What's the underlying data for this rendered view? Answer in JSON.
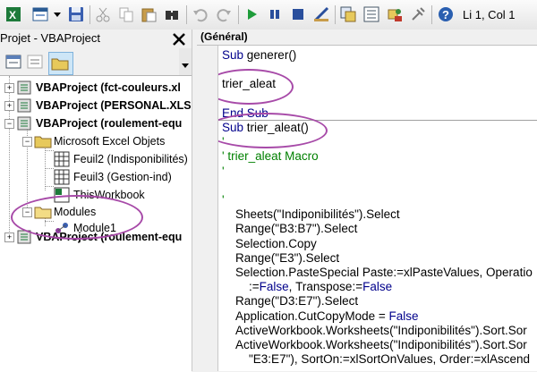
{
  "toolbar": {
    "icons": [
      "excel-icon",
      "insert-userform-icon",
      "dropdown-arrow-icon",
      "save-icon",
      "cut-icon",
      "copy-icon",
      "paste-icon",
      "find-icon",
      "undo-icon",
      "redo-icon",
      "run-icon",
      "break-icon",
      "reset-icon",
      "design-mode-icon",
      "project-explorer-icon",
      "properties-icon",
      "object-browser-icon",
      "toolbox-icon",
      "help-icon"
    ],
    "cursor_position": "Li 1, Col 1"
  },
  "project_panel": {
    "title": "Projet - VBAProject",
    "tree": [
      {
        "label": "VBAProject (fct-couleurs.xl",
        "bold": true,
        "expander": "+"
      },
      {
        "label": "VBAProject (PERSONAL.XLS",
        "bold": true,
        "expander": "+"
      },
      {
        "label": "VBAProject (roulement-equ",
        "bold": true,
        "expander": "-"
      },
      {
        "label": "Microsoft Excel Objets",
        "bold": false,
        "expander": "-"
      },
      {
        "label": "Feuil2 (Indisponibilités)",
        "bold": false
      },
      {
        "label": "Feuil3 (Gestion-ind)",
        "bold": false
      },
      {
        "label": "ThisWorkbook",
        "bold": false
      },
      {
        "label": "Modules",
        "bold": false,
        "expander": "-"
      },
      {
        "label": "Module1",
        "bold": false
      },
      {
        "label": "VBAProject (roulement-equ",
        "bold": true,
        "expander": "+"
      }
    ]
  },
  "code_panel": {
    "object_dropdown": "(Général)",
    "lines": [
      [
        {
          "t": "Sub ",
          "c": "kw"
        },
        {
          "t": "generer()",
          "c": ""
        }
      ],
      [],
      [
        {
          "t": "trier_aleat",
          "c": ""
        }
      ],
      [],
      [
        {
          "t": "End Sub",
          "c": "kw"
        }
      ],
      [
        {
          "t": "Sub ",
          "c": "kw"
        },
        {
          "t": "trier_aleat()",
          "c": ""
        }
      ],
      [
        {
          "t": "'",
          "c": "cm"
        }
      ],
      [
        {
          "t": "' trier_aleat Macro",
          "c": "cm"
        }
      ],
      [
        {
          "t": "'",
          "c": "cm"
        }
      ],
      [],
      [
        {
          "t": "'",
          "c": "cm"
        }
      ],
      [
        {
          "t": "    Sheets(\"Indiponibilités\").Select",
          "c": ""
        }
      ],
      [
        {
          "t": "    Range(\"B3:B7\").Select",
          "c": ""
        }
      ],
      [
        {
          "t": "    Selection.Copy",
          "c": ""
        }
      ],
      [
        {
          "t": "    Range(\"E3\").Select",
          "c": ""
        }
      ],
      [
        {
          "t": "    Selection.PasteSpecial Paste:=xlPasteValues, Operatio",
          "c": ""
        }
      ],
      [
        {
          "t": "        :=",
          "c": ""
        },
        {
          "t": "False",
          "c": "kw"
        },
        {
          "t": ", Transpose:=",
          "c": ""
        },
        {
          "t": "False",
          "c": "kw"
        }
      ],
      [
        {
          "t": "    Range(\"D3:E7\").Select",
          "c": ""
        }
      ],
      [
        {
          "t": "    Application.CutCopyMode = ",
          "c": ""
        },
        {
          "t": "False",
          "c": "kw"
        }
      ],
      [
        {
          "t": "    ActiveWorkbook.Worksheets(\"Indiponibilités\").Sort.Sor",
          "c": ""
        }
      ],
      [
        {
          "t": "    ActiveWorkbook.Worksheets(\"Indiponibilités\").Sort.Sor",
          "c": ""
        }
      ],
      [
        {
          "t": "        \"E3:E7\"), SortOn:=xlSortOnValues, Order:=xlAscend",
          "c": ""
        }
      ]
    ]
  },
  "annotation_color": "#a74aa8"
}
